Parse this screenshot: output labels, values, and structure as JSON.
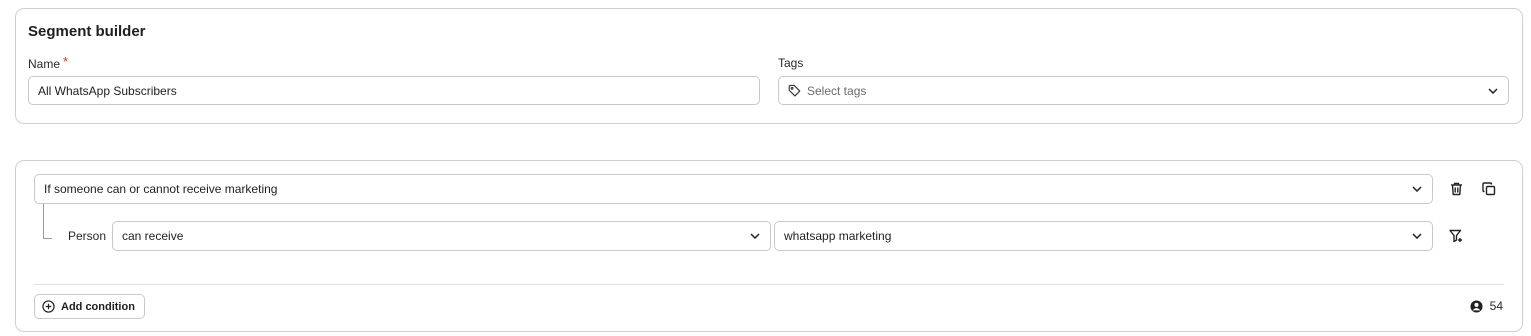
{
  "segment_builder": {
    "title": "Segment builder",
    "name_label": "Name",
    "name_required_mark": "*",
    "name_value": "All WhatsApp Subscribers",
    "tags_label": "Tags",
    "tags_placeholder": "Select tags"
  },
  "condition": {
    "type_value": "If someone can or cannot receive marketing",
    "subject_label": "Person",
    "operator_value": "can receive",
    "channel_value": "whatsapp marketing"
  },
  "footer": {
    "add_condition_label": "Add condition",
    "member_count": "54"
  },
  "icons": {
    "tag": "tag-icon",
    "chevron": "chevron-down-icon",
    "delete": "trash-icon",
    "duplicate": "copy-icon",
    "filter": "filter-add-icon",
    "add": "plus-circle-icon",
    "person": "user-circle-icon"
  },
  "colors": {
    "required": "#d0342c",
    "border": "#c9c9c9",
    "text": "#1f1f1f"
  }
}
